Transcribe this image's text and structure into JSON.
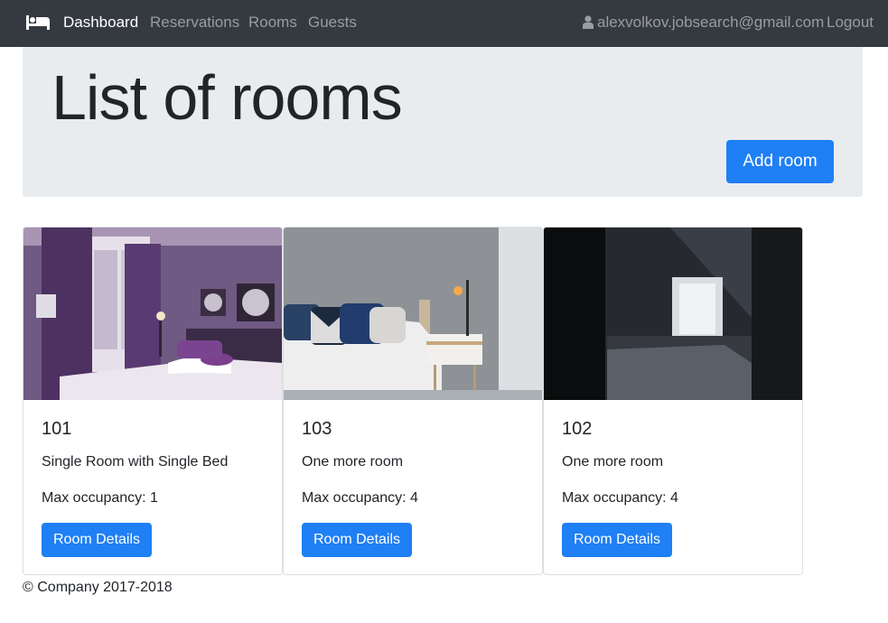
{
  "navbar": {
    "brand_icon": "bed-icon",
    "links": [
      {
        "label": "Dashboard",
        "active": true
      },
      {
        "label": "Reservations",
        "active": false
      },
      {
        "label": "Rooms",
        "active": false
      },
      {
        "label": "Guests",
        "active": false
      }
    ],
    "user_icon": "user-icon",
    "user_email": "alexvolkov.jobsearch@gmail.com",
    "logout_label": "Logout"
  },
  "header": {
    "title": "List of rooms",
    "add_button_label": "Add room"
  },
  "rooms": [
    {
      "number": "101",
      "description": "Single Room with Single Bed",
      "occupancy": "Max occupancy: 1",
      "button_label": "Room Details"
    },
    {
      "number": "103",
      "description": "One more room",
      "occupancy": "Max occupancy: 4",
      "button_label": "Room Details"
    },
    {
      "number": "102",
      "description": "One more room",
      "occupancy": "Max occupancy: 4",
      "button_label": "Room Details"
    }
  ],
  "footer": {
    "text": "© Company 2017-2018"
  },
  "colors": {
    "navbar": "#343a40",
    "primary": "#1f7ff5",
    "jumbotron": "#e9ecef"
  }
}
